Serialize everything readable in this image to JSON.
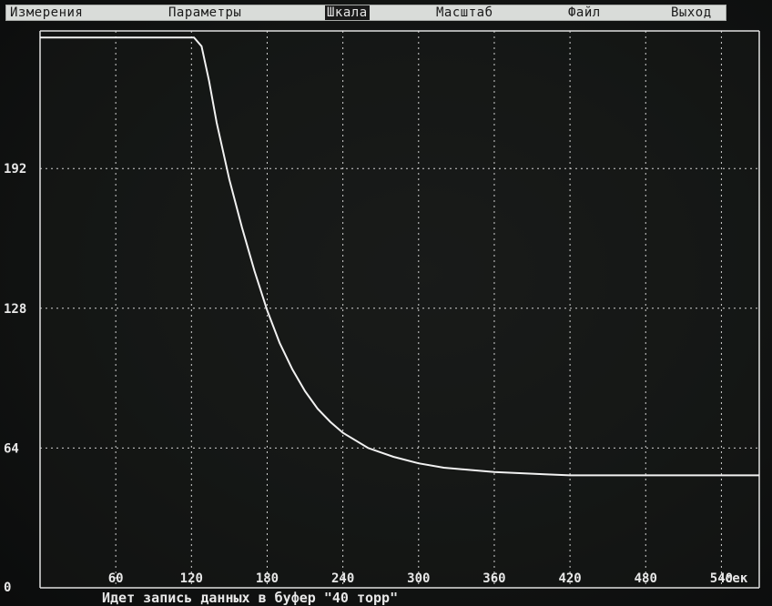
{
  "menu": {
    "items": [
      {
        "label": "Измерения",
        "active": false
      },
      {
        "label": "Параметры",
        "active": false
      },
      {
        "label": "Шкала",
        "active": true
      },
      {
        "label": "Масштаб",
        "active": false
      },
      {
        "label": "Файл",
        "active": false
      },
      {
        "label": "Выход",
        "active": false
      }
    ]
  },
  "status": {
    "text": "Идет запись данных  в буфер \"40 торр\""
  },
  "chart_data": {
    "type": "line",
    "title": "",
    "xlabel": "сек",
    "ylabel": "",
    "xlim": [
      0,
      570
    ],
    "ylim": [
      0,
      255
    ],
    "x_ticks": [
      60,
      120,
      180,
      240,
      300,
      360,
      420,
      480,
      540
    ],
    "y_ticks": [
      0,
      64,
      128,
      192
    ],
    "grid": true,
    "line_color": "#f2f2f2",
    "grid_color": "#d0d0d0",
    "series": [
      {
        "x": [
          0,
          60,
          110,
          122,
          128,
          134,
          140,
          150,
          160,
          170,
          180,
          190,
          200,
          210,
          220,
          230,
          240,
          260,
          280,
          300,
          320,
          340,
          360,
          380,
          400,
          420,
          460,
          500,
          540,
          570
        ],
        "y": [
          252,
          252,
          252,
          252,
          248,
          232,
          213,
          187,
          165,
          145,
          127,
          112,
          100,
          90,
          82,
          76,
          71,
          64,
          60,
          57,
          55,
          54,
          53,
          52.5,
          52,
          51.5,
          51.5,
          51.5,
          51.5,
          51.5
        ]
      }
    ]
  }
}
